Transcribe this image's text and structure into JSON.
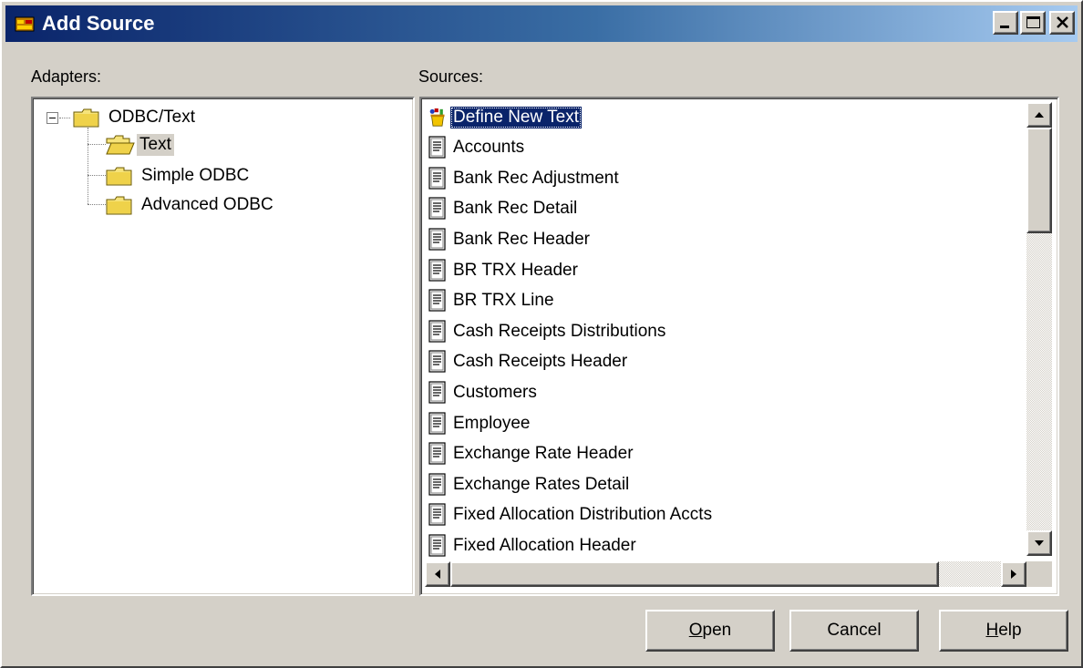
{
  "window": {
    "title": "Add Source"
  },
  "adapters": {
    "label": "Adapters:",
    "root": "ODBC/Text",
    "children": [
      "Text",
      "Simple ODBC",
      "Advanced ODBC"
    ]
  },
  "sources": {
    "label": "Sources:",
    "items": [
      "Define New Text",
      "Accounts",
      "Bank Rec Adjustment",
      "Bank Rec Detail",
      "Bank Rec Header",
      "BR TRX Header",
      "BR TRX Line",
      "Cash Receipts Distributions",
      "Cash Receipts Header",
      "Customers",
      "Employee",
      "Exchange Rate Header",
      "Exchange Rates Detail",
      "Fixed Allocation Distribution Accts",
      "Fixed Allocation Header"
    ],
    "selected_index": 0
  },
  "buttons": {
    "open": {
      "mnemonic": "O",
      "rest": "pen"
    },
    "cancel": "Cancel",
    "help": {
      "mnemonic": "H",
      "rest": "elp"
    }
  },
  "colors": {
    "selection": "#0a246a",
    "face": "#d4d0c8"
  }
}
